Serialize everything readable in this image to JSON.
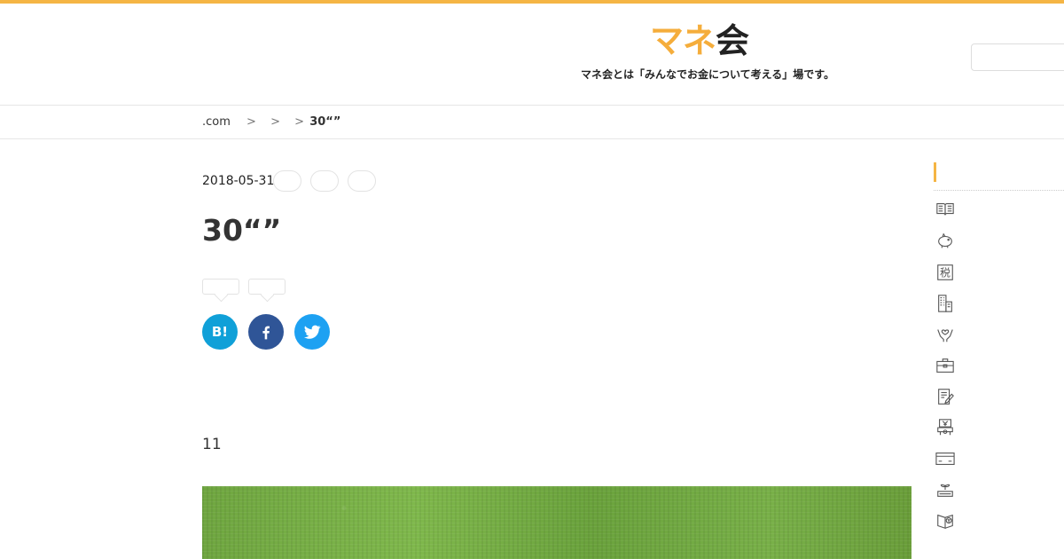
{
  "header": {
    "logo_accent": "マネ",
    "logo_rest": "会",
    "tagline": "マネ会とは「みんなでお金について考える」場です。",
    "search": {
      "value": "",
      "placeholder": ""
    }
  },
  "breadcrumb": {
    "items": [
      ".com",
      ">",
      ">",
      ">"
    ],
    "current": "30“”"
  },
  "article": {
    "date": "2018-05-31",
    "tags": [
      "",
      "",
      ""
    ],
    "title": "30“”",
    "share_counts": [
      "",
      ""
    ],
    "share_buttons": [
      {
        "label": "B!",
        "icon": "hatena-bookmark-icon",
        "color": "#10a0d8"
      },
      {
        "icon": "facebook-icon",
        "color": "#2f5597"
      },
      {
        "icon": "twitter-icon",
        "color": "#1da1f2"
      }
    ],
    "body_text": "11",
    "hero_image": "grass-photo"
  },
  "sidebar": {
    "accent_color": "#f5b544",
    "icons": [
      "book-icon",
      "piggy-bank-icon",
      "tax-icon",
      "building-icon",
      "hands-care-icon",
      "briefcase-icon",
      "document-pen-icon",
      "yen-house-icon",
      "credit-card-icon",
      "sprout-coin-icon",
      "yen-book-icon"
    ],
    "tax_glyph": "税"
  },
  "colors": {
    "accent": "#f5b544",
    "text": "#333333",
    "hatena": "#10a0d8",
    "facebook": "#2f5597",
    "twitter": "#1da1f2"
  }
}
